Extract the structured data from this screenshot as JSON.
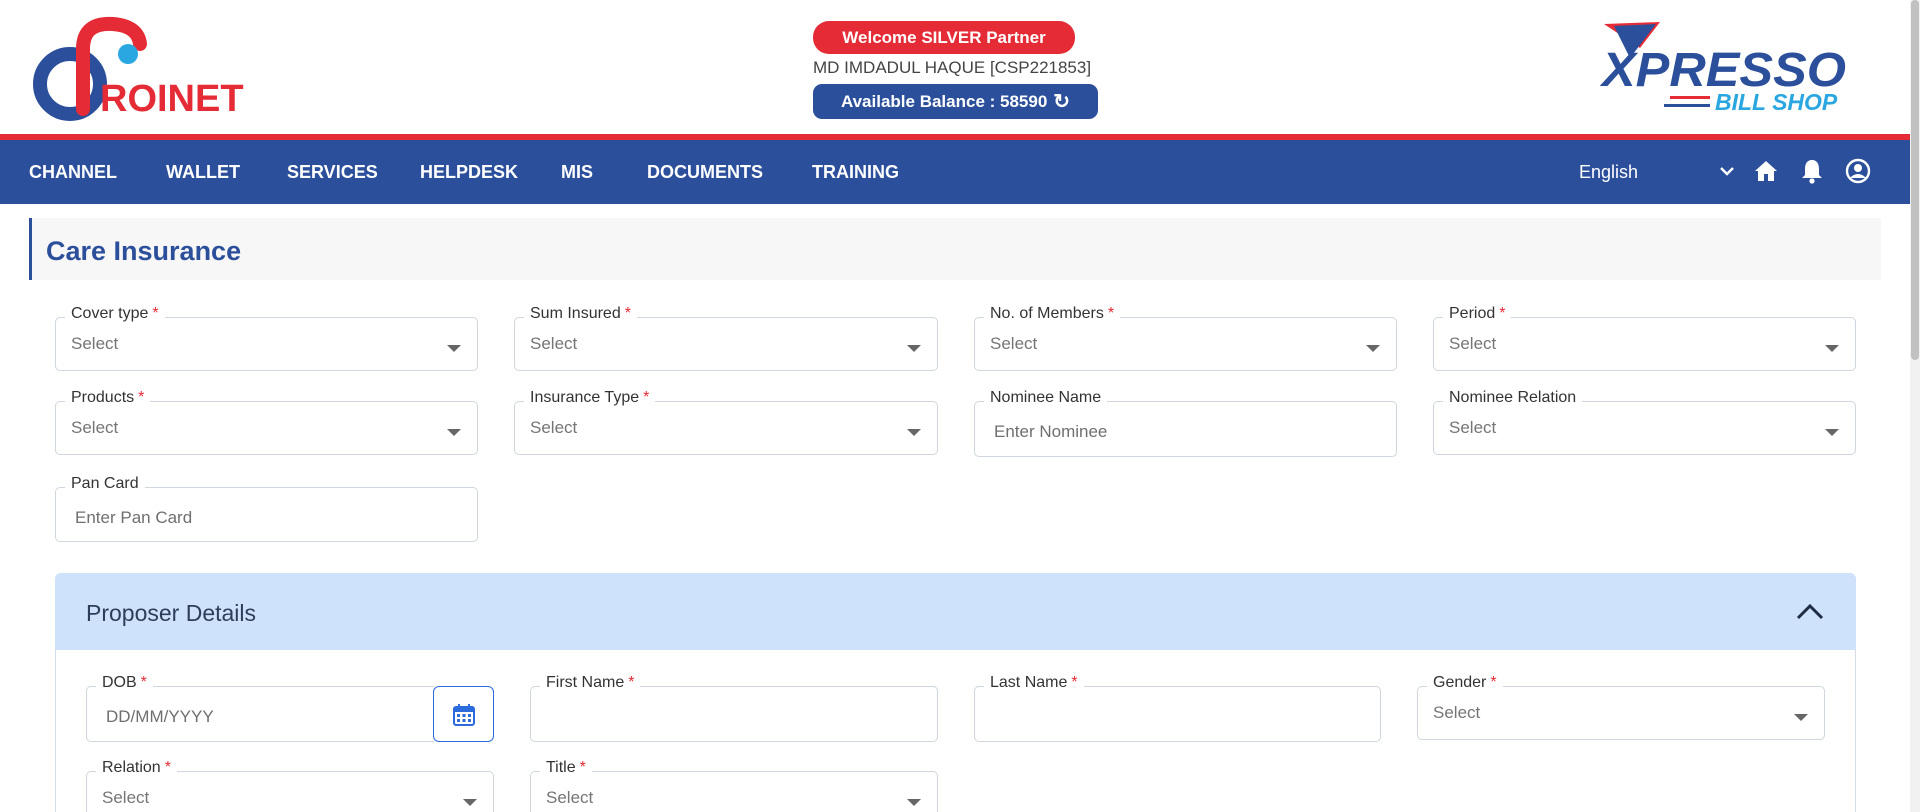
{
  "header": {
    "brand_left": "ROINET",
    "brand_right_top": "XPRESSO",
    "brand_right_bottom": "BILL SHOP",
    "partner_badge": "Welcome SILVER Partner",
    "user_line": "MD IMDADUL HAQUE [CSP221853]",
    "balance_text": "Available Balance : 58590",
    "refresh_icon": "refresh-icon"
  },
  "nav": {
    "items": [
      "CHANNEL",
      "WALLET",
      "SERVICES",
      "HELPDESK",
      "MIS",
      "DOCUMENTS",
      "TRAINING"
    ],
    "language": "English",
    "icons": [
      "chevron-down-icon",
      "home-icon",
      "bell-icon",
      "user-circle-icon"
    ]
  },
  "page": {
    "title": "Care Insurance",
    "fields": {
      "cover_type": {
        "label": "Cover type",
        "value": "Select"
      },
      "sum_insured": {
        "label": "Sum Insured",
        "value": "Select"
      },
      "members": {
        "label": "No. of Members",
        "value": "Select"
      },
      "period": {
        "label": "Period",
        "value": "Select"
      },
      "products": {
        "label": "Products",
        "value": "Select"
      },
      "insurance_type": {
        "label": "Insurance Type",
        "value": "Select"
      },
      "nominee_name": {
        "label": "Nominee Name",
        "placeholder": "Enter Nominee"
      },
      "nominee_relation": {
        "label": "Nominee Relation",
        "value": "Select"
      },
      "pan_card": {
        "label": "Pan Card",
        "placeholder": "Enter Pan Card"
      }
    },
    "required_mark": "*"
  },
  "proposer": {
    "title": "Proposer Details",
    "dob": {
      "label": "DOB",
      "placeholder": "DD/MM/YYYY"
    },
    "first_name": {
      "label": "First Name",
      "value": ""
    },
    "last_name": {
      "label": "Last Name",
      "value": ""
    },
    "gender": {
      "label": "Gender",
      "value": "Select"
    },
    "relation": {
      "label": "Relation",
      "value": "Select"
    },
    "title_field": {
      "label": "Title",
      "value": "Select"
    }
  },
  "colors": {
    "primary": "#2b4f9b",
    "accent": "#e52b35",
    "section_bg": "#cfe2fb"
  }
}
